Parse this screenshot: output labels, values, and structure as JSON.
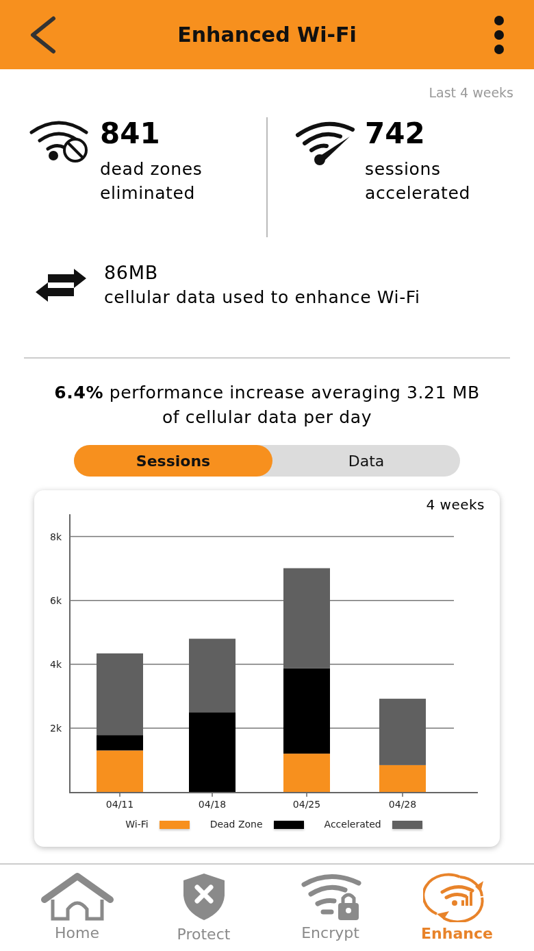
{
  "header": {
    "title": "Enhanced Wi-Fi"
  },
  "period": "Last 4 weeks",
  "stats": [
    {
      "kind": "deadzone",
      "value": "841",
      "label_lines": [
        "dead zones",
        "eliminated"
      ]
    },
    {
      "kind": "accelerated",
      "value": "742",
      "label_lines": [
        "sessions",
        "accelerated"
      ]
    }
  ],
  "cellular": {
    "value": "86MB",
    "label": "cellular data used to enhance Wi-Fi"
  },
  "summary": "**6.4%** performance increase averaging 3.21 MB of cellular data per day",
  "toggle": [
    {
      "label": "Sessions",
      "selected": true
    },
    {
      "label": "Data",
      "selected": false
    }
  ],
  "chart": {
    "range_label": "4 weeks",
    "chart_data": {
      "type": "bar",
      "stacked": true,
      "categories": [
        "04/11",
        "04/18",
        "04/25",
        "04/28"
      ],
      "ylim": [
        0,
        8700
      ],
      "grid": true,
      "yticks": [
        {
          "value": 2000,
          "label": "2k"
        },
        {
          "value": 4000,
          "label": "4k"
        },
        {
          "value": 6000,
          "label": "6k"
        },
        {
          "value": 8000,
          "label": "8k"
        }
      ],
      "series": [
        {
          "name": "Wi-Fi",
          "color": "#f7901e",
          "values": [
            1300,
            null,
            1200,
            840
          ]
        },
        {
          "name": "Dead Zone",
          "color": "#000000",
          "values": [
            480,
            2490,
            2670,
            null
          ]
        },
        {
          "name": "Accelerated",
          "color": "#606060",
          "values": [
            2560,
            2310,
            3140,
            2080
          ]
        }
      ]
    }
  },
  "nav": [
    {
      "kind": "home",
      "label": "Home",
      "selected": false
    },
    {
      "kind": "protect",
      "label": "Protect",
      "selected": false
    },
    {
      "kind": "encrypt",
      "label": "Encrypt",
      "selected": false
    },
    {
      "kind": "enhance",
      "label": "Enhance",
      "selected": true
    }
  ]
}
